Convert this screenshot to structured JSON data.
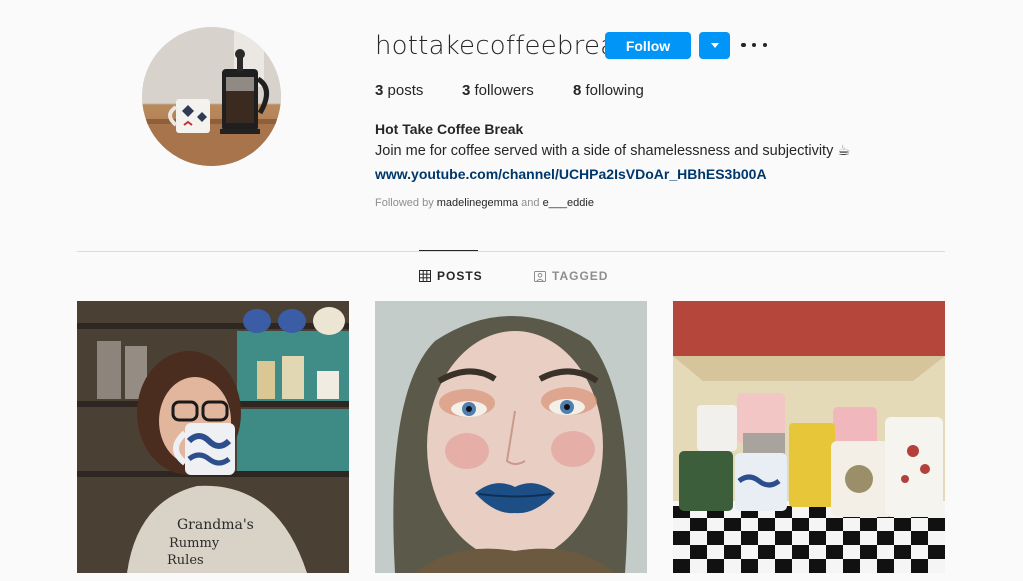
{
  "profile": {
    "username": "hottakecoffeebreak",
    "follow_label": "Follow",
    "full_name": "Hot Take Coffee Break",
    "bio": "Join me for coffee served with a side of shamelessness and subjectivity ☕",
    "link": "www.youtube.com/channel/UCHPa2IsVDoAr_HBhES3b00A",
    "followed_by": {
      "prefix": "Followed by",
      "user1": "madelinegemma",
      "conj": "and",
      "user2": "e___eddie"
    }
  },
  "stats": {
    "posts": {
      "count": "3",
      "label": "posts"
    },
    "followers": {
      "count": "3",
      "label": "followers"
    },
    "following": {
      "count": "8",
      "label": "following"
    }
  },
  "tabs": [
    {
      "label": "POSTS",
      "icon": "grid-icon",
      "active": true
    },
    {
      "label": "TAGGED",
      "icon": "tag-icon",
      "active": false
    }
  ],
  "posts": [
    {
      "subject": "woman drinking from blue and white mug",
      "icon": "photo"
    },
    {
      "subject": "close-up face with blue lipstick",
      "icon": "photo"
    },
    {
      "subject": "mugs on checkered shelf",
      "icon": "photo"
    }
  ],
  "post1_text": {
    "line1": "Grandma's",
    "line2": "Rummy",
    "line3": "Rules"
  },
  "colors": {
    "accent": "#0095f6",
    "link": "#00376b",
    "muted": "#8e8e8e",
    "text": "#262626"
  }
}
